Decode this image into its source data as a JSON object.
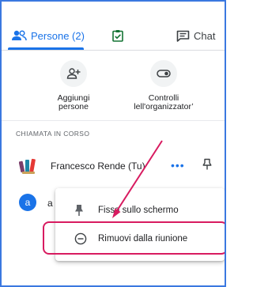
{
  "tabs": {
    "people_label": "Persone (2)",
    "chat_label": "Chat"
  },
  "actions": {
    "add_people": [
      "Aggiungi",
      "persone"
    ],
    "host_controls": [
      "Controlli",
      "lell'organizzator’"
    ]
  },
  "section": {
    "call_label": "CHIAMATA IN CORSO"
  },
  "participants": [
    {
      "name": "Francesco Rende (Tu)",
      "more": "•••"
    },
    {
      "initial": "a",
      "name_visible": "a"
    }
  ],
  "menu": {
    "pin_label": "Fissa sullo schermo",
    "remove_label": "Rimuovi dalla riunione"
  },
  "colors": {
    "accent": "#1a73e8",
    "highlight": "#d81b60",
    "frame": "#3b78e0"
  }
}
